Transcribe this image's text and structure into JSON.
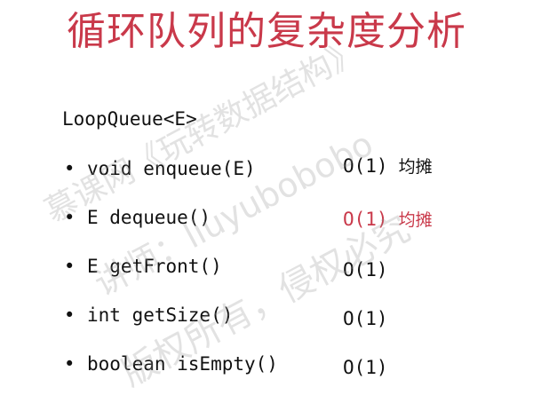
{
  "slide": {
    "title": "循环队列的复杂度分析",
    "class_name": "LoopQueue<E>",
    "methods": [
      {
        "signature": "void enqueue(E)",
        "complexity": "O(1)",
        "note": "均摊"
      },
      {
        "signature": "E dequeue()",
        "complexity": "O(1)",
        "note": "均摊"
      },
      {
        "signature": "E getFront()",
        "complexity": "O(1)",
        "note": ""
      },
      {
        "signature": "int getSize()",
        "complexity": "O(1)",
        "note": ""
      },
      {
        "signature": "boolean isEmpty()",
        "complexity": "O(1)",
        "note": ""
      }
    ],
    "bullet_symbol": "•",
    "watermark": {
      "line1": "慕课网《玩转数据结构》",
      "line2": "讲师：liuyubobobo",
      "line3": "版权所有，侵权必究"
    }
  },
  "colors": {
    "title": "#c9394a",
    "highlight": "#c9394a",
    "text": "#111111",
    "watermark": "#969696"
  }
}
